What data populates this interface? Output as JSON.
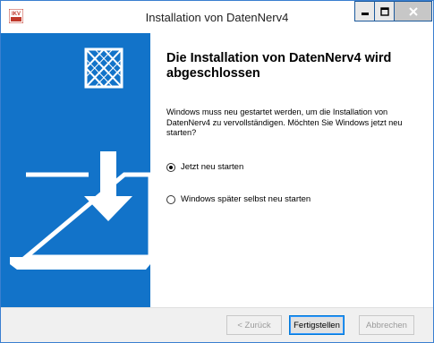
{
  "window": {
    "title": "Installation von DatenNerv4",
    "app_icon": "ikv-icon",
    "accent": "#1273c9"
  },
  "panel": {
    "logo_icon": "box-logo-icon",
    "illustration": "laptop-download-icon"
  },
  "main": {
    "heading": "Die Installation von DatenNerv4 wird abgeschlossen",
    "message": "Windows muss neu gestartet werden, um die Installation von DatenNerv4 zu vervollständigen. Möchten Sie Windows jetzt neu starten?",
    "options": [
      {
        "label": "Jetzt neu starten",
        "selected": true
      },
      {
        "label": "Windows später selbst neu starten",
        "selected": false
      }
    ]
  },
  "footer": {
    "back_label": "< Zurück",
    "finish_label": "Fertigstellen",
    "cancel_label": "Abbrechen"
  }
}
